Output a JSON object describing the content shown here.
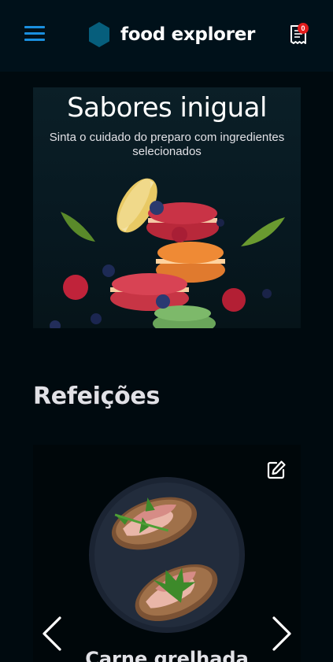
{
  "header": {
    "brand_name": "food explorer",
    "menu_icon": "hamburger-menu-icon",
    "brand_icon": "hexagon-logo-icon",
    "orders_icon": "receipt-icon",
    "orders_count": "0",
    "accent_color": "#1a8fdf"
  },
  "banner": {
    "title": "Sabores inigual",
    "subtitle": "Sinta o cuidado do preparo com ingredientes selecionados",
    "image": "macarons-illustration"
  },
  "sections": [
    {
      "title": "Refeições",
      "cards": [
        {
          "name": "Carne grelhada",
          "image": "bruschetta-with-bacon-and-arugula",
          "edit_icon": "pencil-edit-icon"
        }
      ],
      "prev_icon": "chevron-left-icon",
      "next_icon": "chevron-right-icon"
    }
  ]
}
